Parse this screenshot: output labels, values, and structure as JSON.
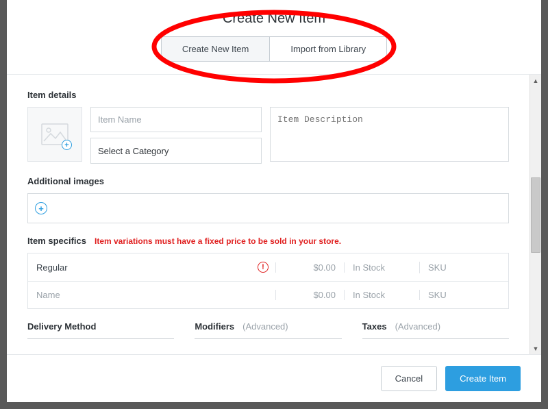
{
  "header": {
    "title": "Create New Item",
    "tabs": [
      {
        "label": "Create New Item",
        "active": true
      },
      {
        "label": "Import from Library",
        "active": false
      }
    ]
  },
  "sections": {
    "item_details": {
      "heading": "Item details"
    },
    "additional_images": {
      "heading": "Additional images"
    },
    "item_specifics": {
      "heading": "Item specifics",
      "warning": "Item variations must have a fixed price to be sold in your store."
    },
    "delivery": {
      "heading": "Delivery Method"
    },
    "modifiers": {
      "heading": "Modifiers",
      "suffix": "(Advanced)"
    },
    "taxes": {
      "heading": "Taxes",
      "suffix": "(Advanced)"
    }
  },
  "fields": {
    "item_name": {
      "placeholder": "Item Name",
      "value": ""
    },
    "category": {
      "label": "Select a Category"
    },
    "item_description": {
      "placeholder": "Item Description",
      "value": ""
    }
  },
  "specifics": {
    "rows": [
      {
        "name": "Regular",
        "price": "$0.00",
        "stock": "In Stock",
        "sku_placeholder": "SKU",
        "warn": true,
        "trash": true
      },
      {
        "name_placeholder": "Name",
        "price": "$0.00",
        "stock": "In Stock",
        "sku_placeholder": "SKU",
        "warn": false,
        "trash": false
      }
    ]
  },
  "footer": {
    "cancel": "Cancel",
    "submit": "Create Item"
  },
  "icons": {
    "plus": "+",
    "exclaim": "!"
  }
}
